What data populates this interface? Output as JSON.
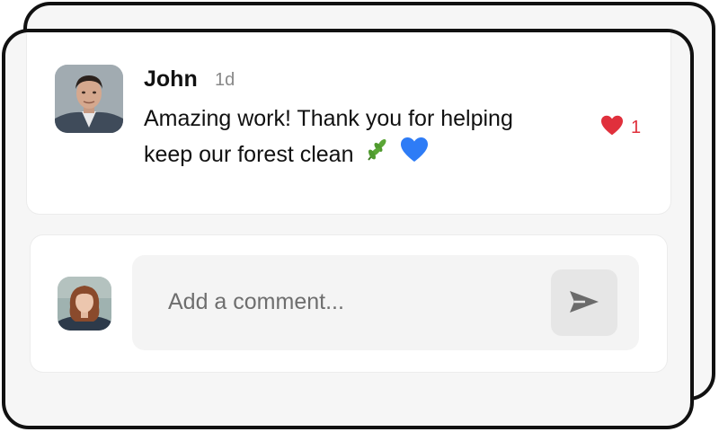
{
  "comment": {
    "author": "John",
    "time": "1d",
    "text": "Amazing work! Thank you for helping keep our forest clean",
    "emojis": [
      "herb-icon",
      "blue-heart-icon"
    ],
    "likes": "1",
    "like_icon": "heart-icon"
  },
  "composer": {
    "placeholder": "Add a comment...",
    "send_icon": "send-icon"
  },
  "colors": {
    "like": "#e0303c",
    "blue_heart": "#2e7cf6",
    "leaf": "#4f9a2e",
    "send_icon": "#6b6b6b"
  }
}
